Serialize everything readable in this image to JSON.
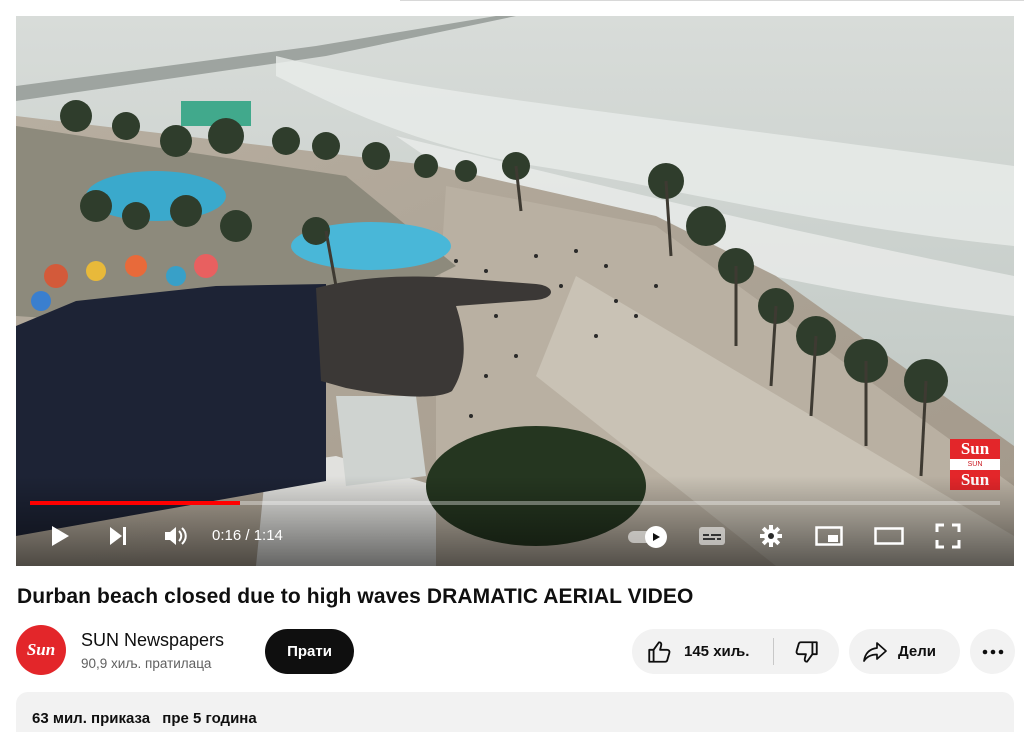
{
  "video": {
    "time_current": "0:16",
    "time_total": "1:14",
    "time_display": "0:16 / 1:14",
    "progress": 0.216,
    "watermark": {
      "top": "Sun",
      "middle": "SUN Newspapers",
      "bottom": "Sun"
    }
  },
  "controls": {
    "play_icon": "play-icon",
    "next_icon": "next-icon",
    "volume_icon": "volume-icon",
    "autoplay_icon": "autoplay-toggle",
    "subtitles_icon": "subtitles-icon",
    "settings_icon": "gear-icon",
    "miniplayer_icon": "miniplayer-icon",
    "theater_icon": "theater-icon",
    "fullscreen_icon": "fullscreen-icon"
  },
  "title": "Durban beach closed due to high waves DRAMATIC AERIAL VIDEO",
  "channel": {
    "avatar_text": "Sun",
    "name": "SUN Newspapers",
    "subscribers": "90,9 хиљ. пратилаца"
  },
  "actions": {
    "subscribe": "Прати",
    "likes": "145 хиљ.",
    "share": "Дели"
  },
  "description": {
    "views": "63 мил. приказа",
    "age": "пре 5 година"
  },
  "colors": {
    "progress": "#ff0000",
    "brand": "#e3262a",
    "subscribe_bg": "#0f0f0f",
    "pill_bg": "#f2f2f2"
  }
}
